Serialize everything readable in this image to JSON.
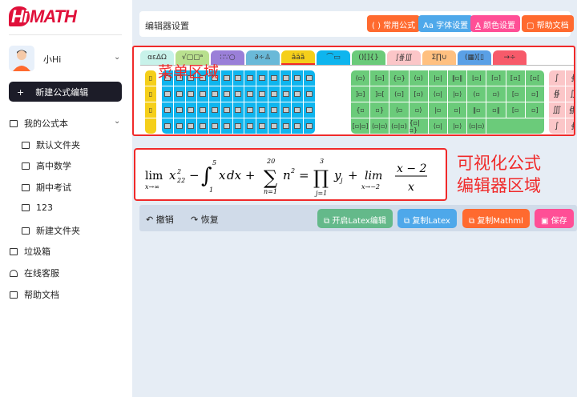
{
  "logo": {
    "text": "HiMATH"
  },
  "user": {
    "name": "小Hi"
  },
  "new_formula": "新建公式编辑",
  "nav": {
    "notebook": "我的公式本",
    "folders": [
      "默认文件夹",
      "高中数学",
      "期中考试",
      "123"
    ],
    "new_folder": "新建文件夹",
    "trash": "垃圾箱",
    "support": "在线客服",
    "help": "帮助文档"
  },
  "header": {
    "title": "编辑器设置",
    "buttons": [
      {
        "icon": "( )",
        "label": "常用公式",
        "color": "#ff6a2f"
      },
      {
        "icon": "Aa",
        "label": "字体设置",
        "color": "#4ea8ea"
      },
      {
        "icon": "A",
        "label": "颜色设置",
        "color": "#ff4f96"
      },
      {
        "icon": "▢",
        "label": "帮助文档",
        "color": "#ff6a2f"
      }
    ]
  },
  "toolbar": {
    "overlay": "菜单区域",
    "tabs": [
      {
        "label": "αεΔΩ",
        "color": "#c8f2ea"
      },
      {
        "label": "√▢▢ᵃ",
        "color": "#b9e08e"
      },
      {
        "label": "∷∵○",
        "color": "#9a7fd8"
      },
      {
        "label": "∂∻♙",
        "color": "#6ab9d8"
      },
      {
        "label": "âäã",
        "color": "#f5cf1a"
      },
      {
        "label": "⌒▭",
        "color": "#0fb5ee"
      },
      {
        "label": "()[]{}",
        "color": "#6bcb7a"
      },
      {
        "label": "∫∯∭",
        "color": "#fbc6c8"
      },
      {
        "label": "Σ∏∪",
        "color": "#ffc080"
      },
      {
        "label": "(▦)[▯",
        "color": "#5aa0e6"
      },
      {
        "label": "→÷",
        "color": "#f75a6a"
      }
    ],
    "brackets": [
      "(▫)",
      "[▫]",
      "{▫}",
      "⟨▫⟩",
      "|▫|",
      "‖▫‖",
      "⌊▫⌋",
      "⌈▫⌉",
      "⟦▫⟧",
      "[▫[",
      "]▫]",
      "]▫[",
      "(▫]",
      "[▫)",
      "⟨▫|",
      "|▫⟩",
      "(▫",
      "▫)",
      "[▫",
      "▫]",
      "{▫",
      "▫}",
      "⟨▫",
      "▫⟩",
      "|▫",
      "▫|",
      "‖▫",
      "▫‖",
      "[▫",
      "▫]",
      "[▫|▫]",
      "⟨▫|▫⟩",
      "(▫|▫)",
      "{▫|▫}",
      "⟨▫|",
      "|▫⟩",
      "⟨▫|▫⟩"
    ],
    "integrals": [
      "∫",
      "∮",
      "∯",
      "∬",
      "∭",
      "∰",
      "∫",
      "∳"
    ]
  },
  "formula": {
    "overlay_line1": "可视化公式",
    "overlay_line2": "编辑器区域"
  },
  "actions": {
    "undo": "撤销",
    "redo": "恢复",
    "latex_edit": "开启Latex编辑",
    "copy_latex": "复制Latex",
    "copy_mathml": "复制Mathml",
    "save": "保存"
  }
}
